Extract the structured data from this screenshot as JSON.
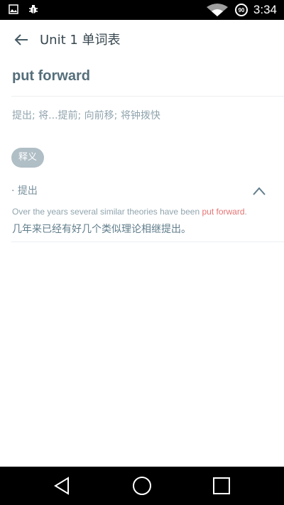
{
  "status_bar": {
    "time": "3:34",
    "battery_level": "90",
    "icons": [
      "image-icon",
      "bug-icon",
      "wifi-icon",
      "battery-icon"
    ]
  },
  "toolbar": {
    "title": "Unit 1 单词表",
    "back_icon": "arrow-left-icon"
  },
  "word": {
    "headword": "put forward",
    "summary": "提出; 将...提前; 向前移; 将钟拨快"
  },
  "definition_section": {
    "chip_label": "释义",
    "senses": [
      {
        "label": "· 提出",
        "expanded": true,
        "example": {
          "en_before": "Over the years several similar theories have been ",
          "en_highlight": "put forward",
          "en_after": ".",
          "zh": "几年来已经有好几个类似理论相继提出。"
        }
      }
    ]
  },
  "nav_bar": {
    "icons": [
      "back-triangle-icon",
      "home-circle-icon",
      "recents-square-icon"
    ]
  },
  "colors": {
    "highlight": "#e57373",
    "chip_bg": "#b0bec5",
    "headword": "#546e7a"
  }
}
